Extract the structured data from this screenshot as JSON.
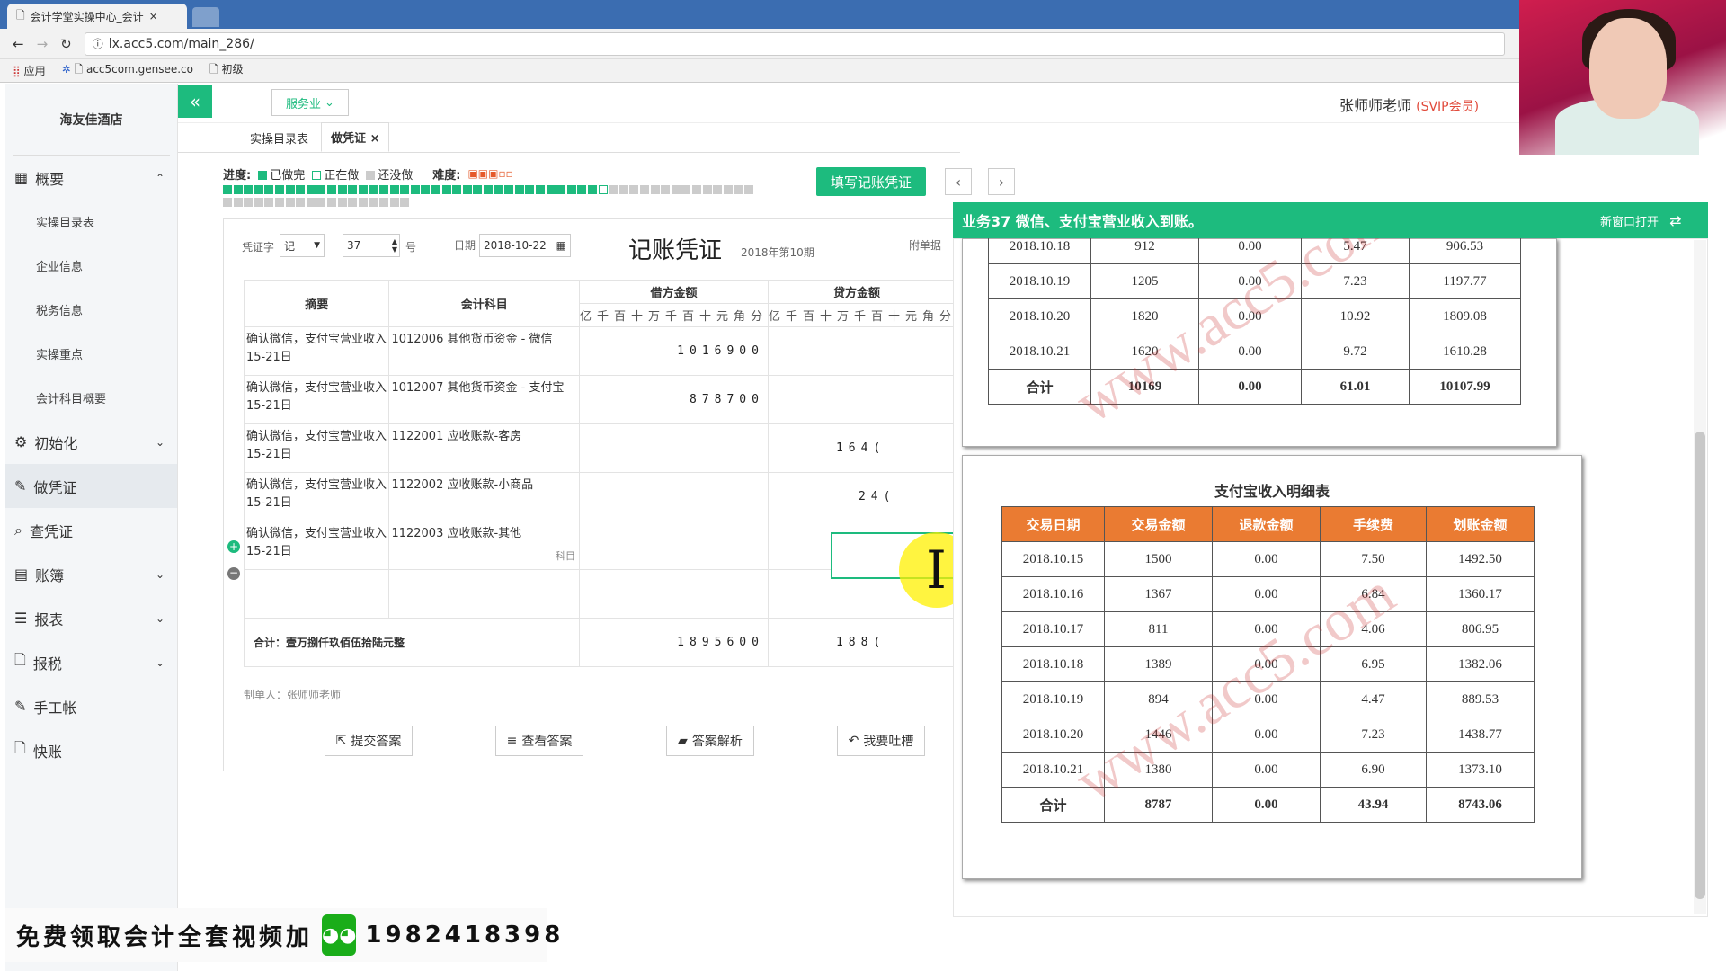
{
  "browser": {
    "tab_title": "会计学堂实操中心_会计",
    "tab_close": "×",
    "url": "lx.acc5.com/main_286/",
    "bookmarks": [
      "应用",
      "acc5com.gensee.co",
      "初级"
    ]
  },
  "sidebar": {
    "company": "海友佳酒店",
    "items": [
      {
        "label": "概要",
        "icon": "grid-icon",
        "chevron": "⌃"
      },
      {
        "label": "实操目录表",
        "sub": true
      },
      {
        "label": "企业信息",
        "sub": true
      },
      {
        "label": "税务信息",
        "sub": true
      },
      {
        "label": "实操重点",
        "sub": true
      },
      {
        "label": "会计科目概要",
        "sub": true
      },
      {
        "label": "初始化",
        "icon": "gear-icon",
        "chevron": "⌄"
      },
      {
        "label": "做凭证",
        "icon": "pen-icon",
        "active": true
      },
      {
        "label": "查凭证",
        "icon": "search-icon"
      },
      {
        "label": "账簿",
        "icon": "book-icon",
        "chevron": "⌄"
      },
      {
        "label": "报表",
        "icon": "list-icon",
        "chevron": "⌄"
      },
      {
        "label": "报税",
        "icon": "file-icon",
        "chevron": "⌄"
      },
      {
        "label": "手工帐",
        "icon": "pen-icon"
      },
      {
        "label": "快账",
        "icon": "file-icon"
      }
    ]
  },
  "topbar": {
    "collapse": "«",
    "industry": "服务业",
    "user_name": "张师师老师",
    "user_badge": "(SVIP会员)"
  },
  "tabs": [
    {
      "label": "实操目录表"
    },
    {
      "label": "做凭证",
      "close": "×"
    }
  ],
  "progress": {
    "label": "进度:",
    "done": "已做完",
    "doing": "正在做",
    "todo": "还没做",
    "difficulty_label": "难度:",
    "difficulty": 3,
    "difficulty_max": 5,
    "total_tasks": 69,
    "done_tasks": 36,
    "current_task": 37,
    "colors": {
      "done": "#1dbb7e",
      "doing": "#ffffff",
      "todo": "#cccccc"
    }
  },
  "fill_button": "填写记账凭证",
  "nav": {
    "prev": "‹",
    "next": "›"
  },
  "voucher": {
    "word_label": "凭证字",
    "word": "记",
    "number": "37",
    "number_suffix": "号",
    "date_label": "日期",
    "date": "2018-10-22",
    "title": "记账凭证",
    "period": "2018年第10期",
    "attach_label": "附单据",
    "headers": {
      "summary": "摘要",
      "account": "会计科目",
      "debit": "借方金额",
      "credit": "贷方金额"
    },
    "digit_units": "亿千百十万千百十元角分",
    "rows": [
      {
        "summary": "确认微信，支付宝营业收入15-21日",
        "account": "1012006 其他货币资金 - 微信",
        "debit": "1016900",
        "credit": ""
      },
      {
        "summary": "确认微信，支付宝营业收入15-21日",
        "account": "1012007 其他货币资金 - 支付宝",
        "debit": "878700",
        "credit": ""
      },
      {
        "summary": "确认微信，支付宝营业收入15-21日",
        "account": "1122001 应收账款-客房",
        "debit": "",
        "credit": "164("
      },
      {
        "summary": "确认微信，支付宝营业收入15-21日",
        "account": "1122002 应收账款-小商品",
        "debit": "",
        "credit": "24("
      },
      {
        "summary": "确认微信，支付宝营业收入15-21日",
        "account": "1122003 应收账款-其他",
        "account_hint": "科目",
        "debit": "",
        "credit": ""
      }
    ],
    "total_label": "合计：壹万捌仟玖佰伍拾陆元整",
    "total_debit": "1895600",
    "total_credit": "188(",
    "maker": "制单人：张师师老师",
    "buttons": [
      "提交答案",
      "查看答案",
      "答案解析",
      "我要吐槽"
    ]
  },
  "task": {
    "title": "业务37 微信、支付宝营业收入到账。",
    "new_window": "新窗口打开"
  },
  "wechat_table": {
    "partial_row": [
      "2018.10.18",
      "912",
      "0.00",
      "5.47",
      "906.53"
    ],
    "rows": [
      [
        "2018.10.19",
        "1205",
        "0.00",
        "7.23",
        "1197.77"
      ],
      [
        "2018.10.20",
        "1820",
        "0.00",
        "10.92",
        "1809.08"
      ],
      [
        "2018.10.21",
        "1620",
        "0.00",
        "9.72",
        "1610.28"
      ]
    ],
    "total": [
      "合计",
      "10169",
      "0.00",
      "61.01",
      "10107.99"
    ]
  },
  "alipay_table": {
    "title": "支付宝收入明细表",
    "headers": [
      "交易日期",
      "交易金额",
      "退款金额",
      "手续费",
      "划账金额"
    ],
    "rows": [
      [
        "2018.10.15",
        "1500",
        "0.00",
        "7.50",
        "1492.50"
      ],
      [
        "2018.10.16",
        "1367",
        "0.00",
        "6.84",
        "1360.17"
      ],
      [
        "2018.10.17",
        "811",
        "0.00",
        "4.06",
        "806.95"
      ],
      [
        "2018.10.18",
        "1389",
        "0.00",
        "6.95",
        "1382.06"
      ],
      [
        "2018.10.19",
        "894",
        "0.00",
        "4.47",
        "889.53"
      ],
      [
        "2018.10.20",
        "1446",
        "0.00",
        "7.23",
        "1438.77"
      ],
      [
        "2018.10.21",
        "1380",
        "0.00",
        "6.90",
        "1373.10"
      ]
    ],
    "total": [
      "合计",
      "8787",
      "0.00",
      "43.94",
      "8743.06"
    ]
  },
  "watermark": "www.acc5.com",
  "banner": {
    "text": "免费领取会计全套视频加",
    "phone": "1982418398"
  }
}
